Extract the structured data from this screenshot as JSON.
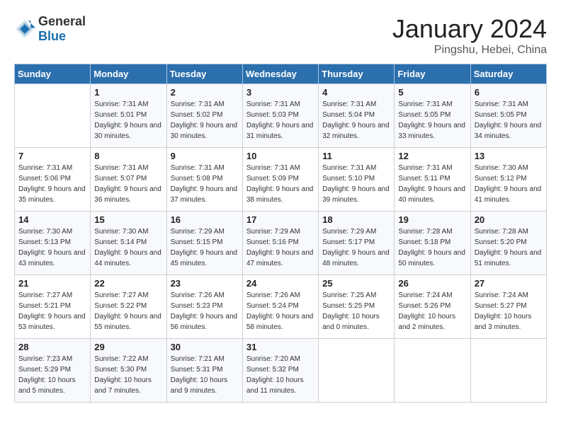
{
  "header": {
    "logo_general": "General",
    "logo_blue": "Blue",
    "month_year": "January 2024",
    "location": "Pingshu, Hebei, China"
  },
  "days_of_week": [
    "Sunday",
    "Monday",
    "Tuesday",
    "Wednesday",
    "Thursday",
    "Friday",
    "Saturday"
  ],
  "weeks": [
    [
      {
        "day": "",
        "sunrise": "",
        "sunset": "",
        "daylight": ""
      },
      {
        "day": "1",
        "sunrise": "Sunrise: 7:31 AM",
        "sunset": "Sunset: 5:01 PM",
        "daylight": "Daylight: 9 hours and 30 minutes."
      },
      {
        "day": "2",
        "sunrise": "Sunrise: 7:31 AM",
        "sunset": "Sunset: 5:02 PM",
        "daylight": "Daylight: 9 hours and 30 minutes."
      },
      {
        "day": "3",
        "sunrise": "Sunrise: 7:31 AM",
        "sunset": "Sunset: 5:03 PM",
        "daylight": "Daylight: 9 hours and 31 minutes."
      },
      {
        "day": "4",
        "sunrise": "Sunrise: 7:31 AM",
        "sunset": "Sunset: 5:04 PM",
        "daylight": "Daylight: 9 hours and 32 minutes."
      },
      {
        "day": "5",
        "sunrise": "Sunrise: 7:31 AM",
        "sunset": "Sunset: 5:05 PM",
        "daylight": "Daylight: 9 hours and 33 minutes."
      },
      {
        "day": "6",
        "sunrise": "Sunrise: 7:31 AM",
        "sunset": "Sunset: 5:05 PM",
        "daylight": "Daylight: 9 hours and 34 minutes."
      }
    ],
    [
      {
        "day": "7",
        "sunrise": "Sunrise: 7:31 AM",
        "sunset": "Sunset: 5:06 PM",
        "daylight": "Daylight: 9 hours and 35 minutes."
      },
      {
        "day": "8",
        "sunrise": "Sunrise: 7:31 AM",
        "sunset": "Sunset: 5:07 PM",
        "daylight": "Daylight: 9 hours and 36 minutes."
      },
      {
        "day": "9",
        "sunrise": "Sunrise: 7:31 AM",
        "sunset": "Sunset: 5:08 PM",
        "daylight": "Daylight: 9 hours and 37 minutes."
      },
      {
        "day": "10",
        "sunrise": "Sunrise: 7:31 AM",
        "sunset": "Sunset: 5:09 PM",
        "daylight": "Daylight: 9 hours and 38 minutes."
      },
      {
        "day": "11",
        "sunrise": "Sunrise: 7:31 AM",
        "sunset": "Sunset: 5:10 PM",
        "daylight": "Daylight: 9 hours and 39 minutes."
      },
      {
        "day": "12",
        "sunrise": "Sunrise: 7:31 AM",
        "sunset": "Sunset: 5:11 PM",
        "daylight": "Daylight: 9 hours and 40 minutes."
      },
      {
        "day": "13",
        "sunrise": "Sunrise: 7:30 AM",
        "sunset": "Sunset: 5:12 PM",
        "daylight": "Daylight: 9 hours and 41 minutes."
      }
    ],
    [
      {
        "day": "14",
        "sunrise": "Sunrise: 7:30 AM",
        "sunset": "Sunset: 5:13 PM",
        "daylight": "Daylight: 9 hours and 43 minutes."
      },
      {
        "day": "15",
        "sunrise": "Sunrise: 7:30 AM",
        "sunset": "Sunset: 5:14 PM",
        "daylight": "Daylight: 9 hours and 44 minutes."
      },
      {
        "day": "16",
        "sunrise": "Sunrise: 7:29 AM",
        "sunset": "Sunset: 5:15 PM",
        "daylight": "Daylight: 9 hours and 45 minutes."
      },
      {
        "day": "17",
        "sunrise": "Sunrise: 7:29 AM",
        "sunset": "Sunset: 5:16 PM",
        "daylight": "Daylight: 9 hours and 47 minutes."
      },
      {
        "day": "18",
        "sunrise": "Sunrise: 7:29 AM",
        "sunset": "Sunset: 5:17 PM",
        "daylight": "Daylight: 9 hours and 48 minutes."
      },
      {
        "day": "19",
        "sunrise": "Sunrise: 7:28 AM",
        "sunset": "Sunset: 5:18 PM",
        "daylight": "Daylight: 9 hours and 50 minutes."
      },
      {
        "day": "20",
        "sunrise": "Sunrise: 7:28 AM",
        "sunset": "Sunset: 5:20 PM",
        "daylight": "Daylight: 9 hours and 51 minutes."
      }
    ],
    [
      {
        "day": "21",
        "sunrise": "Sunrise: 7:27 AM",
        "sunset": "Sunset: 5:21 PM",
        "daylight": "Daylight: 9 hours and 53 minutes."
      },
      {
        "day": "22",
        "sunrise": "Sunrise: 7:27 AM",
        "sunset": "Sunset: 5:22 PM",
        "daylight": "Daylight: 9 hours and 55 minutes."
      },
      {
        "day": "23",
        "sunrise": "Sunrise: 7:26 AM",
        "sunset": "Sunset: 5:23 PM",
        "daylight": "Daylight: 9 hours and 56 minutes."
      },
      {
        "day": "24",
        "sunrise": "Sunrise: 7:26 AM",
        "sunset": "Sunset: 5:24 PM",
        "daylight": "Daylight: 9 hours and 58 minutes."
      },
      {
        "day": "25",
        "sunrise": "Sunrise: 7:25 AM",
        "sunset": "Sunset: 5:25 PM",
        "daylight": "Daylight: 10 hours and 0 minutes."
      },
      {
        "day": "26",
        "sunrise": "Sunrise: 7:24 AM",
        "sunset": "Sunset: 5:26 PM",
        "daylight": "Daylight: 10 hours and 2 minutes."
      },
      {
        "day": "27",
        "sunrise": "Sunrise: 7:24 AM",
        "sunset": "Sunset: 5:27 PM",
        "daylight": "Daylight: 10 hours and 3 minutes."
      }
    ],
    [
      {
        "day": "28",
        "sunrise": "Sunrise: 7:23 AM",
        "sunset": "Sunset: 5:29 PM",
        "daylight": "Daylight: 10 hours and 5 minutes."
      },
      {
        "day": "29",
        "sunrise": "Sunrise: 7:22 AM",
        "sunset": "Sunset: 5:30 PM",
        "daylight": "Daylight: 10 hours and 7 minutes."
      },
      {
        "day": "30",
        "sunrise": "Sunrise: 7:21 AM",
        "sunset": "Sunset: 5:31 PM",
        "daylight": "Daylight: 10 hours and 9 minutes."
      },
      {
        "day": "31",
        "sunrise": "Sunrise: 7:20 AM",
        "sunset": "Sunset: 5:32 PM",
        "daylight": "Daylight: 10 hours and 11 minutes."
      },
      {
        "day": "",
        "sunrise": "",
        "sunset": "",
        "daylight": ""
      },
      {
        "day": "",
        "sunrise": "",
        "sunset": "",
        "daylight": ""
      },
      {
        "day": "",
        "sunrise": "",
        "sunset": "",
        "daylight": ""
      }
    ]
  ]
}
